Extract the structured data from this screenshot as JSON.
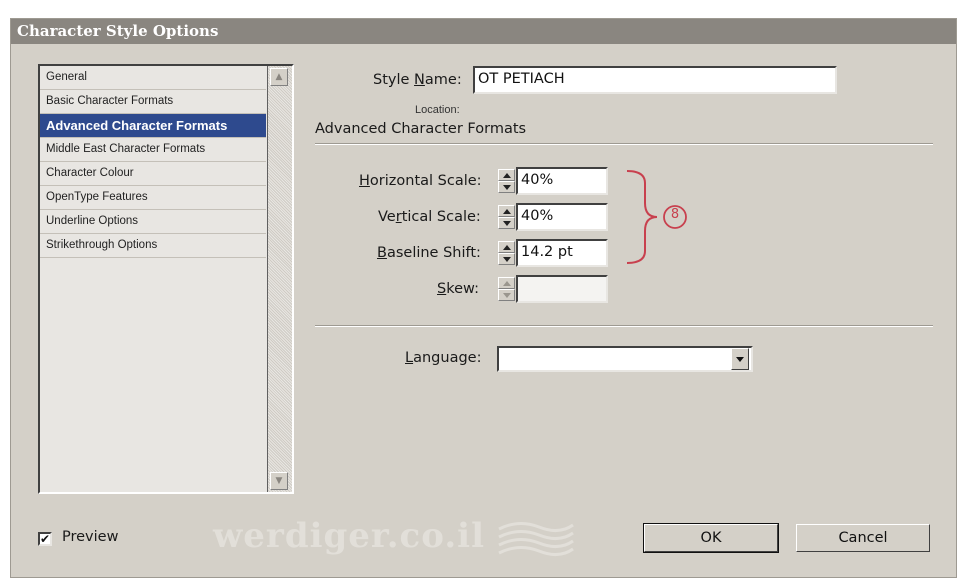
{
  "dialog": {
    "title": "Character Style Options"
  },
  "sidebar": {
    "items": [
      {
        "label": "General",
        "selected": false
      },
      {
        "label": "Basic Character Formats",
        "selected": false
      },
      {
        "label": "Advanced Character Formats",
        "selected": true
      },
      {
        "label": "Middle East Character Formats",
        "selected": false
      },
      {
        "label": "Character Colour",
        "selected": false
      },
      {
        "label": "OpenType Features",
        "selected": false
      },
      {
        "label": "Underline Options",
        "selected": false
      },
      {
        "label": "Strikethrough Options",
        "selected": false
      }
    ]
  },
  "style_name": {
    "label_pre": "Style ",
    "label_key": "N",
    "label_post": "ame:",
    "value": "OT PETIACH"
  },
  "location_label": "Location:",
  "section_title": "Advanced Character Formats",
  "fields": {
    "horizontal_scale": {
      "label_key": "H",
      "label_post": "orizontal Scale:",
      "value": "40%"
    },
    "vertical_scale": {
      "label_pre": "Ve",
      "label_key": "r",
      "label_post": "tical Scale:",
      "value": "40%"
    },
    "baseline_shift": {
      "label_key": "B",
      "label_post": "aseline Shift:",
      "value": "14.2 pt"
    },
    "skew": {
      "label_key": "S",
      "label_post": "kew:",
      "value": ""
    }
  },
  "annotation": {
    "number": "8",
    "color": "#c8404e"
  },
  "language": {
    "label_key": "L",
    "label_post": "anguage:",
    "value": ""
  },
  "preview": {
    "label": "Preview",
    "checked": true,
    "check_glyph": "✔"
  },
  "buttons": {
    "ok": "OK",
    "cancel": "Cancel"
  },
  "watermark": {
    "text": "werdiger.co.il"
  },
  "colors": {
    "dialog_bg": "#d4d0c8",
    "title_bg": "#8a8680",
    "selection": "#2e4a8e"
  }
}
